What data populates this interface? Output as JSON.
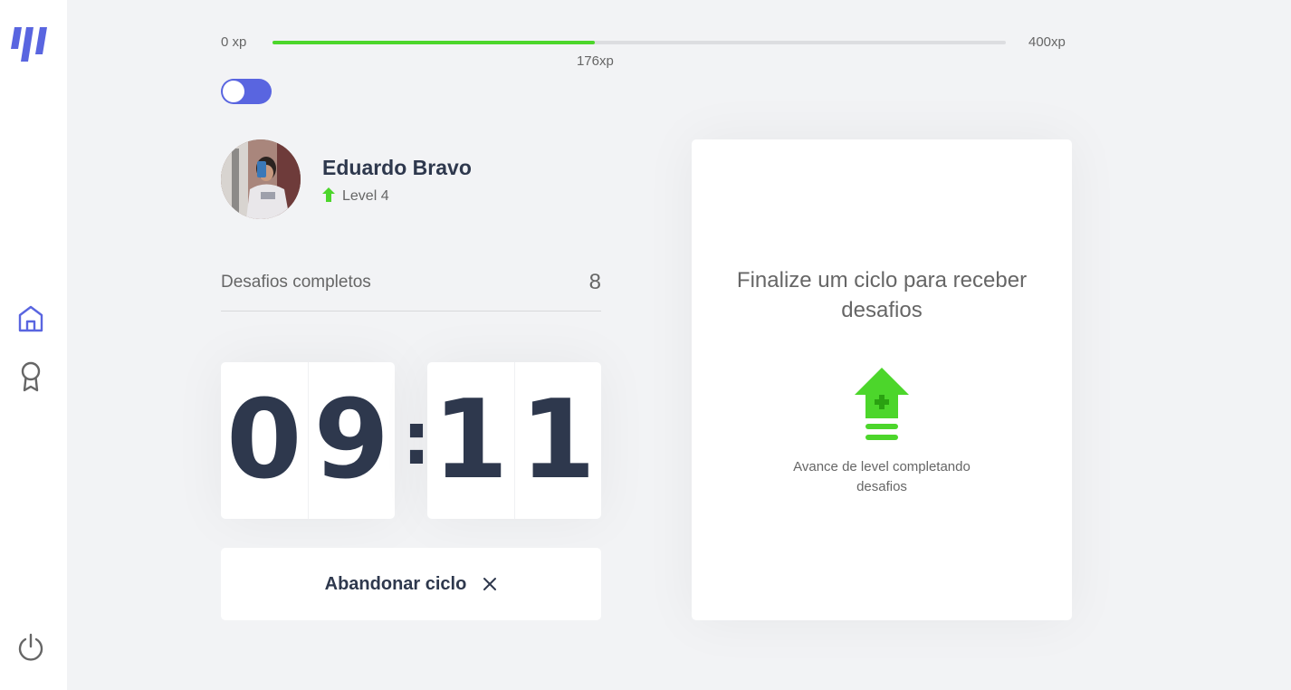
{
  "sidebar": {
    "logo": "moveit-logo",
    "nav": [
      {
        "id": "home",
        "icon": "home-icon",
        "active": true,
        "color": "#5965e0"
      },
      {
        "id": "award",
        "icon": "award-icon",
        "active": false,
        "color": "#666666"
      }
    ],
    "logout_icon": "power-icon"
  },
  "xp": {
    "min_label": "0 xp",
    "max_label": "400xp",
    "current_label": "176xp",
    "current": 176,
    "max": 400,
    "bar_color": "#4cd62b"
  },
  "theme_toggle": {
    "checked": true,
    "color": "#5965e0"
  },
  "profile": {
    "name": "Eduardo Bravo",
    "level_label": "Level 4",
    "level_icon": "level-up-arrow-icon"
  },
  "stats": {
    "completed_label": "Desafios completos",
    "completed_value": "8"
  },
  "countdown": {
    "minutes": [
      "0",
      "9"
    ],
    "separator": ":",
    "seconds": [
      "1",
      "1"
    ]
  },
  "abandon_button": {
    "label": "Abandonar ciclo",
    "icon": "close-icon"
  },
  "challenge_box": {
    "title": "Finalize um ciclo para receber desafios",
    "icon": "level-up-icon",
    "hint": "Avance de level completando desafios"
  },
  "colors": {
    "accent": "#5965e0",
    "green": "#4cd62b",
    "text": "#666666",
    "title": "#2e384d",
    "background": "#f2f3f5"
  }
}
